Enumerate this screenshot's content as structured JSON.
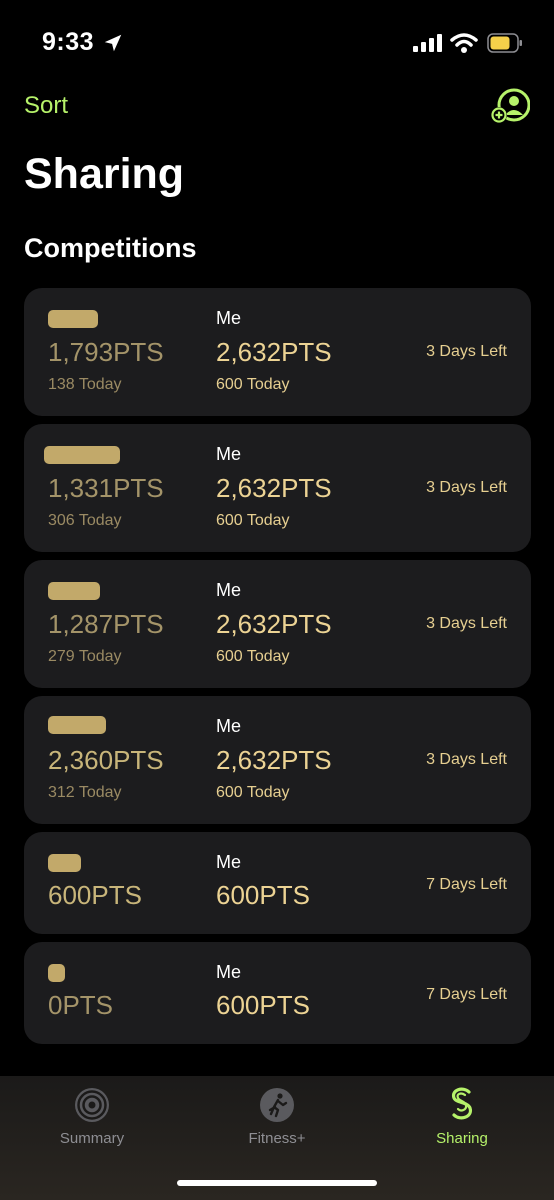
{
  "status": {
    "time": "9:33"
  },
  "nav": {
    "sort_label": "Sort",
    "add_icon": "person-add-icon"
  },
  "title": "Sharing",
  "section": "Competitions",
  "colors": {
    "accent": "#b6f26a",
    "gold": "#ecd394",
    "card": "#1c1c1e"
  },
  "competitions": [
    {
      "friend_pts": "1,793PTS",
      "friend_today": "138 Today",
      "me_label": "Me",
      "me_pts": "2,632PTS",
      "me_today": "600 Today",
      "days_left": "3 Days Left"
    },
    {
      "friend_pts": "1,331PTS",
      "friend_today": "306 Today",
      "me_label": "Me",
      "me_pts": "2,632PTS",
      "me_today": "600 Today",
      "days_left": "3 Days Left"
    },
    {
      "friend_pts": "1,287PTS",
      "friend_today": "279 Today",
      "me_label": "Me",
      "me_pts": "2,632PTS",
      "me_today": "600 Today",
      "days_left": "3 Days Left"
    },
    {
      "friend_pts": "2,360PTS",
      "friend_today": "312 Today",
      "me_label": "Me",
      "me_pts": "2,632PTS",
      "me_today": "600 Today",
      "days_left": "3 Days Left"
    },
    {
      "friend_pts": "600PTS",
      "me_label": "Me",
      "me_pts": "600PTS",
      "days_left": "7 Days Left"
    },
    {
      "friend_pts": "0PTS",
      "me_label": "Me",
      "me_pts": "600PTS",
      "days_left": "7 Days Left"
    }
  ],
  "tabs": [
    {
      "label": "Summary",
      "icon": "activity-rings-icon",
      "active": false
    },
    {
      "label": "Fitness+",
      "icon": "runner-icon",
      "active": false
    },
    {
      "label": "Sharing",
      "icon": "sharing-icon",
      "active": true
    }
  ]
}
